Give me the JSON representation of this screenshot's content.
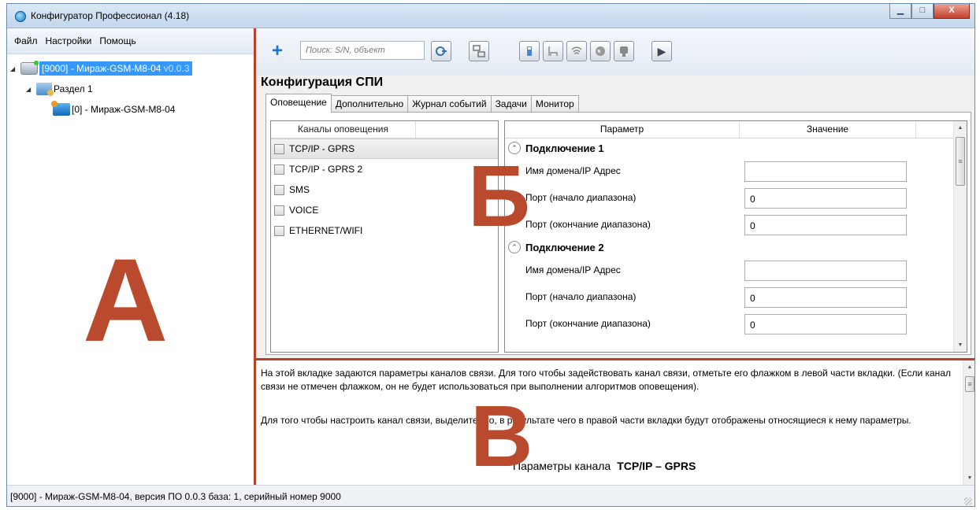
{
  "window": {
    "title": "Конфигуратор Профессионал (4.18)",
    "minimize": "▁",
    "maximize": "□",
    "close": "X"
  },
  "menu": [
    "Файл",
    "Настройки",
    "Помощь"
  ],
  "toolbar": {
    "search_placeholder": "Поиск: S/N, объект",
    "plus": "+",
    "play": "▶"
  },
  "tree": {
    "device_label": "[9000] - Мираж-GSM-M8-04",
    "device_version": "v0.0.3",
    "section_label": "Раздел 1",
    "object_label": "[0] - Мираж-GSM-M8-04"
  },
  "annotations": {
    "a": "А",
    "b": "Б",
    "v": "В"
  },
  "config": {
    "title": "Конфигурация СПИ",
    "tabs": [
      "Оповещение",
      "Дополнительно",
      "Журнал событий",
      "Задачи",
      "Монитор"
    ],
    "channels_header": "Каналы оповещения",
    "channels": [
      "TCP/IP - GPRS",
      "TCP/IP - GPRS 2",
      "SMS",
      "VOICE",
      "ETHERNET/WIFI"
    ],
    "param_header": "Параметр",
    "value_header": "Значение",
    "groups": [
      {
        "title": "Подключение 1",
        "params": [
          {
            "label": "Имя домена/IP Адрес",
            "value": ""
          },
          {
            "label": "Порт (начало диапазона)",
            "value": "0"
          },
          {
            "label": "Порт (окончание диапазона)",
            "value": "0"
          }
        ]
      },
      {
        "title": "Подключение 2",
        "params": [
          {
            "label": "Имя домена/IP Адрес",
            "value": ""
          },
          {
            "label": "Порт (начало диапазона)",
            "value": "0"
          },
          {
            "label": "Порт (окончание диапазона)",
            "value": "0"
          }
        ]
      }
    ]
  },
  "description": {
    "para1": "На этой вкладке задаются параметры каналов связи. Для того чтобы задействовать канал связи, отметьте его флажком в левой части вкладки. (Если канал связи не отмечен флажком, он не будет использоваться при выполнении алгоритмов оповещения).",
    "para2": "Для того чтобы настроить канал связи, выделите его, в результате чего в правой части вкладки будут отображены относящиеся к нему параметры.",
    "channel_title_prefix": "Параметры канала",
    "channel_title_name": "TCP/IP – GPRS"
  },
  "status": "[9000] - Мираж-GSM-M8-04, версия ПО 0.0.3 база: 1, серийный номер 9000",
  "colors": {
    "accent": "#3399ff",
    "annotation": "#b94a2e"
  }
}
